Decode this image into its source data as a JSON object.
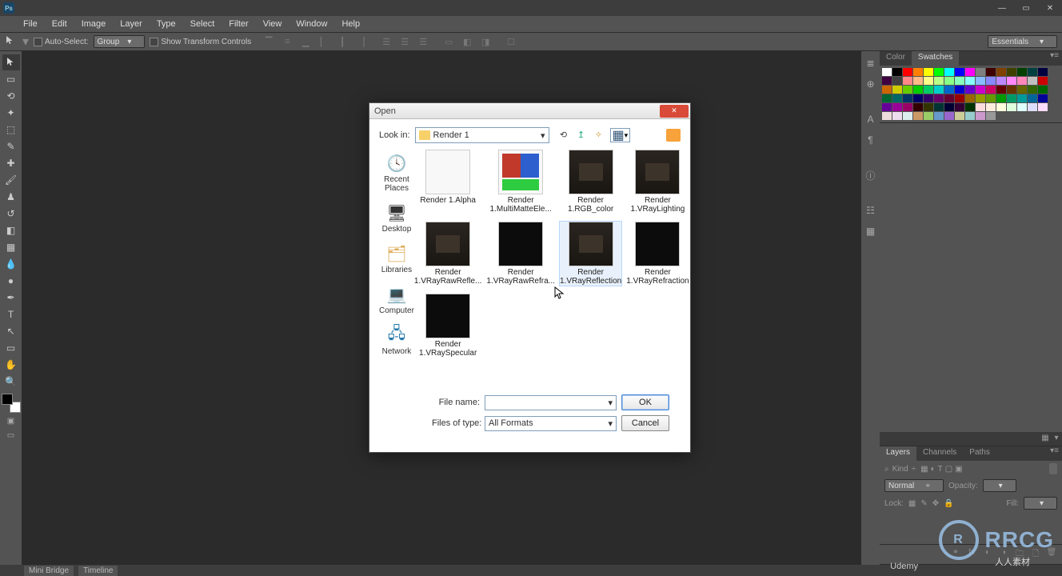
{
  "titlebar": {
    "logo_text": "Ps"
  },
  "menu": [
    "File",
    "Edit",
    "Image",
    "Layer",
    "Type",
    "Select",
    "Filter",
    "View",
    "Window",
    "Help"
  ],
  "options": {
    "auto_select_label": "Auto-Select:",
    "auto_select_value": "Group",
    "show_transform_label": "Show Transform Controls",
    "workspace": "Essentials"
  },
  "panels": {
    "color_tab": "Color",
    "swatches_tab": "Swatches",
    "layers_tab": "Layers",
    "channels_tab": "Channels",
    "paths_tab": "Paths",
    "kind_label": "Kind",
    "blend_mode": "Normal",
    "opacity_label": "Opacity:",
    "opacity_value": "",
    "lock_label": "Lock:",
    "fill_label": "Fill:",
    "fill_value": ""
  },
  "statusbar": {
    "minibridge": "Mini Bridge",
    "timeline": "Timeline"
  },
  "dialog": {
    "title": "Open",
    "lookin_label": "Look in:",
    "lookin_value": "Render 1",
    "places": [
      "Recent Places",
      "Desktop",
      "Libraries",
      "Computer",
      "Network"
    ],
    "files": [
      {
        "name": "Render 1.Alpha",
        "thumb": "white"
      },
      {
        "name": "Render 1.MultiMatteEle...",
        "thumb": "rgb"
      },
      {
        "name": "Render 1.RGB_color",
        "thumb": "room"
      },
      {
        "name": "Render 1.VRayLighting",
        "thumb": "room"
      },
      {
        "name": "Render 1.VRayRawRefle...",
        "thumb": "room"
      },
      {
        "name": "Render 1.VRayRawRefra...",
        "thumb": "dark"
      },
      {
        "name": "Render 1.VRayReflection",
        "thumb": "room",
        "hovered": true
      },
      {
        "name": "Render 1.VRayRefraction",
        "thumb": "dark"
      },
      {
        "name": "Render 1.VRaySpecular",
        "thumb": "dark"
      }
    ],
    "filename_label": "File name:",
    "filename_value": "",
    "filetype_label": "Files of type:",
    "filetype_value": "All Formats",
    "ok_label": "OK",
    "cancel_label": "Cancel"
  },
  "swatch_colors": [
    "#ffffff",
    "#000000",
    "#f00",
    "#ff8000",
    "#ff0",
    "#0f0",
    "#0ff",
    "#00f",
    "#f0f",
    "#808080",
    "#400000",
    "#804000",
    "#404000",
    "#004000",
    "#004040",
    "#000040",
    "#400040",
    "#404040",
    "#f88",
    "#fb8",
    "#ff8",
    "#bf8",
    "#8f8",
    "#8fb",
    "#8ff",
    "#8bf",
    "#88f",
    "#b8f",
    "#f8f",
    "#f8b",
    "#c0c0c0",
    "#c00",
    "#c60",
    "#cc0",
    "#6c0",
    "#0c0",
    "#0c6",
    "#0cc",
    "#06c",
    "#00c",
    "#60c",
    "#c0c",
    "#c06",
    "#600",
    "#630",
    "#660",
    "#360",
    "#060",
    "#063",
    "#066",
    "#036",
    "#006",
    "#306",
    "#606",
    "#603",
    "#900",
    "#960",
    "#990",
    "#690",
    "#090",
    "#096",
    "#099",
    "#069",
    "#009",
    "#609",
    "#909",
    "#906",
    "#300",
    "#330",
    "#033",
    "#003",
    "#303",
    "#030",
    "#fdd",
    "#fed",
    "#ffd",
    "#dfd",
    "#dff",
    "#ddf",
    "#fdf",
    "#edd",
    "#ede",
    "#dee",
    "#c96",
    "#9c6",
    "#69c",
    "#96c",
    "#cc9",
    "#9cc",
    "#c9c",
    "#999"
  ],
  "watermark": {
    "logo": "R",
    "text": "RRCG",
    "sub": "人人素材",
    "udemy": "Udemy"
  }
}
